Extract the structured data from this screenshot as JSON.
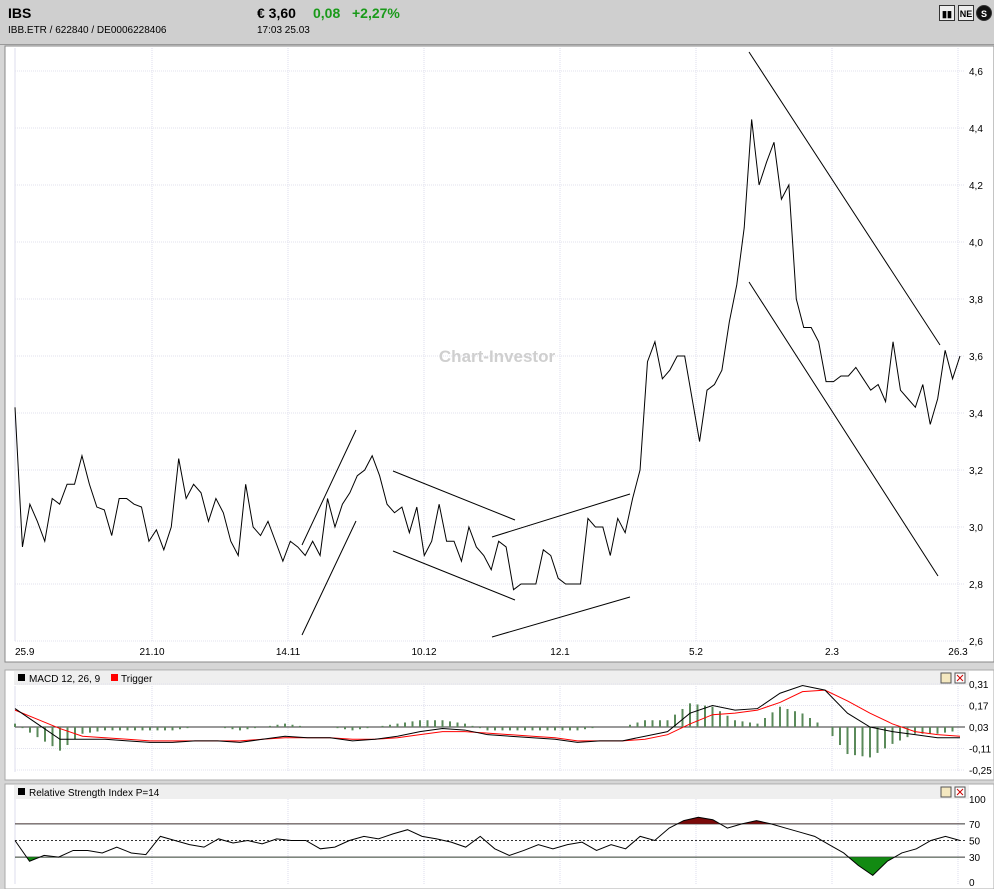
{
  "header": {
    "symbol": "IBS",
    "ids": "IBB.ETR  /  622840  /  DE0006228406",
    "price": "€ 3,60",
    "change": "0,08",
    "change_pct": "+2,27%",
    "time": "17:03   25.03",
    "icons": [
      "bar-chart-icon",
      "news-icon",
      "s-icon"
    ],
    "news_label": "NE",
    "s_label": "S"
  },
  "watermark": "Chart-Investor",
  "colors": {
    "up": "#1a9a1a",
    "macd": "#000000",
    "trigger": "#ff0000",
    "hist": "#5a8a5a",
    "rsi_over": "#7a0a0a",
    "rsi_under": "#128a12"
  },
  "chart_data": [
    {
      "type": "line",
      "title": "IBS price",
      "xlabels": [
        "25.9",
        "21.10",
        "14.11",
        "10.12",
        "12.1",
        "5.2",
        "2.3",
        "26.3"
      ],
      "yticks": [
        "2,6",
        "2,8",
        "3,0",
        "3,2",
        "3,4",
        "3,6",
        "3,8",
        "4,0",
        "4,2",
        "4,4",
        "4,6"
      ],
      "ylim": [
        2.6,
        4.6
      ],
      "values": [
        3.42,
        2.93,
        3.08,
        3.02,
        2.95,
        3.1,
        3.08,
        3.15,
        3.15,
        3.25,
        3.15,
        3.07,
        3.06,
        2.97,
        3.1,
        3.1,
        3.08,
        3.07,
        2.95,
        2.99,
        2.92,
        3.0,
        3.24,
        3.1,
        3.15,
        3.12,
        3.02,
        3.1,
        3.05,
        2.95,
        2.9,
        3.15,
        3.0,
        2.97,
        3.02,
        2.95,
        2.88,
        2.95,
        2.93,
        2.9,
        2.95,
        2.9,
        3.1,
        3.0,
        3.08,
        3.12,
        3.18,
        3.2,
        3.25,
        3.18,
        3.08,
        3.05,
        3.07,
        2.98,
        3.07,
        2.9,
        2.95,
        3.08,
        2.95,
        2.95,
        2.88,
        3.0,
        2.93,
        2.9,
        2.85,
        2.95,
        2.93,
        2.78,
        2.8,
        2.8,
        2.8,
        2.92,
        2.9,
        2.82,
        2.8,
        2.8,
        2.8,
        3.03,
        3.0,
        3.0,
        2.9,
        3.03,
        2.98,
        3.1,
        3.2,
        3.58,
        3.65,
        3.52,
        3.55,
        3.6,
        3.6,
        3.45,
        3.3,
        3.48,
        3.5,
        3.55,
        3.72,
        3.85,
        4.05,
        4.43,
        4.2,
        4.28,
        4.35,
        4.15,
        4.2,
        3.8,
        3.7,
        3.7,
        3.65,
        3.51,
        3.51,
        3.53,
        3.53,
        3.56,
        3.52,
        3.48,
        3.5,
        3.44,
        3.65,
        3.48,
        3.45,
        3.42,
        3.5,
        3.36,
        3.45,
        3.62,
        3.52,
        3.6
      ]
    },
    {
      "type": "line",
      "title": "MACD 12, 26, 9",
      "legend": [
        "MACD 12, 26, 9",
        "Trigger"
      ],
      "yticks": [
        "0,31",
        "0,17",
        "0,03",
        "-0,11",
        "-0,25"
      ],
      "ylim": [
        -0.25,
        0.31
      ],
      "macd": [
        0.15,
        0.05,
        -0.05,
        -0.05,
        -0.05,
        -0.06,
        -0.07,
        -0.07,
        -0.06,
        -0.06,
        -0.07,
        -0.05,
        -0.03,
        -0.04,
        -0.04,
        -0.06,
        -0.05,
        -0.03,
        0.0,
        0.02,
        0.01,
        -0.02,
        -0.03,
        -0.04,
        -0.05,
        -0.07,
        -0.06,
        -0.06,
        -0.03,
        0.0,
        0.12,
        0.17,
        0.14,
        0.15,
        0.25,
        0.3,
        0.27,
        0.12,
        0.03,
        0.0,
        -0.02,
        -0.04,
        -0.04
      ],
      "trigger": [
        0.14,
        0.08,
        0.02,
        -0.03,
        -0.04,
        -0.05,
        -0.06,
        -0.06,
        -0.06,
        -0.06,
        -0.06,
        -0.05,
        -0.04,
        -0.04,
        -0.04,
        -0.05,
        -0.05,
        -0.04,
        -0.02,
        0.0,
        0.0,
        -0.01,
        -0.02,
        -0.03,
        -0.04,
        -0.06,
        -0.06,
        -0.06,
        -0.05,
        -0.02,
        0.05,
        0.11,
        0.12,
        0.14,
        0.19,
        0.26,
        0.27,
        0.2,
        0.12,
        0.05,
        0.0,
        -0.02,
        -0.03
      ]
    },
    {
      "type": "line",
      "title": "Relative Strength Index P=14",
      "yticks": [
        "100",
        "70",
        "50",
        "30",
        "0"
      ],
      "ylim": [
        0,
        100
      ],
      "values": [
        50,
        25,
        32,
        30,
        38,
        38,
        35,
        42,
        35,
        33,
        55,
        50,
        45,
        42,
        52,
        47,
        50,
        46,
        52,
        50,
        50,
        40,
        42,
        50,
        55,
        52,
        58,
        63,
        55,
        52,
        48,
        42,
        55,
        40,
        32,
        38,
        45,
        40,
        45,
        48,
        38,
        45,
        40,
        55,
        50,
        65,
        74,
        78,
        75,
        65,
        70,
        74,
        70,
        65,
        60,
        55,
        45,
        35,
        20,
        8,
        25,
        35,
        40,
        50,
        55,
        50
      ]
    }
  ]
}
